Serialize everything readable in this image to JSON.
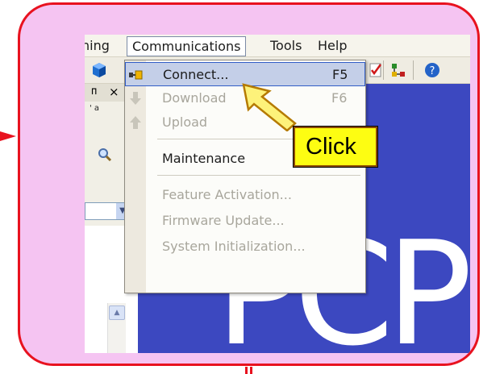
{
  "menubar": {
    "items": [
      {
        "label": "ning"
      },
      {
        "label": "Communications"
      },
      {
        "label": "Tools"
      },
      {
        "label": "Help"
      }
    ]
  },
  "panel": {
    "pin_glyph": "ᴨ",
    "close_glyph": "×",
    "tiny_label": "' a"
  },
  "dropdown": {
    "items": [
      {
        "label": "Connect...",
        "shortcut": "F5",
        "enabled": true,
        "icon": "connect-plug-icon"
      },
      {
        "label": "Download",
        "shortcut": "F6",
        "enabled": false,
        "icon": "download-arrow-icon"
      },
      {
        "label": "Upload",
        "shortcut": "",
        "enabled": false,
        "icon": "upload-arrow-icon"
      },
      {
        "label": "Maintenance",
        "shortcut": "",
        "enabled": true
      },
      {
        "label": "Feature Activation...",
        "shortcut": "",
        "enabled": false
      },
      {
        "label": "Firmware Update...",
        "shortcut": "",
        "enabled": false
      },
      {
        "label": "System Initialization...",
        "shortcut": "",
        "enabled": false
      }
    ]
  },
  "callout": {
    "label": "Click"
  },
  "background": {
    "text": "PCP"
  },
  "colors": {
    "frame_border": "#e8121f",
    "frame_fill": "#f5c4f2",
    "highlight": "#c4cfe8",
    "callout_fill": "#fdfd12",
    "blue_bg": "#3c48c0"
  }
}
